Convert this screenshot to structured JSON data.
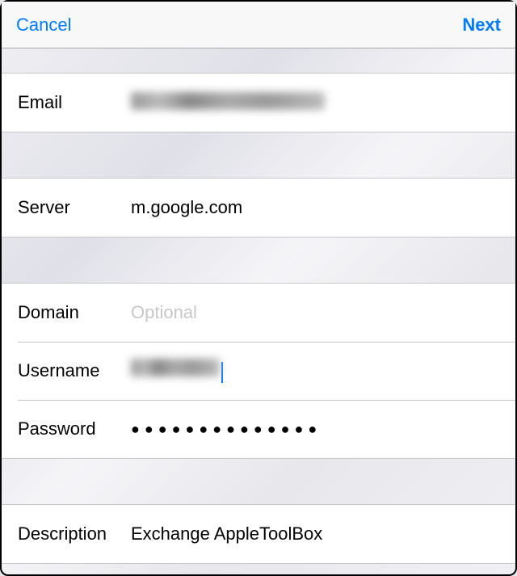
{
  "nav": {
    "cancel": "Cancel",
    "next": "Next"
  },
  "fields": {
    "email": {
      "label": "Email",
      "value": ""
    },
    "server": {
      "label": "Server",
      "value": "m.google.com"
    },
    "domain": {
      "label": "Domain",
      "value": "",
      "placeholder": "Optional"
    },
    "username": {
      "label": "Username",
      "value": ""
    },
    "password": {
      "label": "Password",
      "value": "●●●●●●●●●●●●●●"
    },
    "description": {
      "label": "Description",
      "value": "Exchange AppleToolBox"
    }
  }
}
